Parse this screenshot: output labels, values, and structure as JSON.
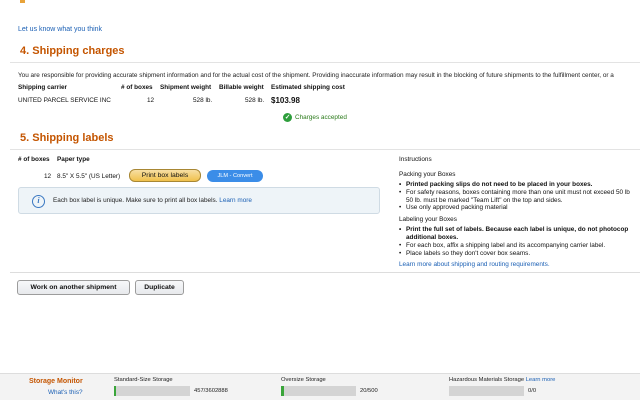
{
  "feedback_link": "Let us know what you think",
  "charges": {
    "title": "4. Shipping charges",
    "responsibility": "You are responsible for providing accurate shipment information and for the actual cost of the shipment. Providing inaccurate information may result in the blocking of future shipments to the fulfillment center, or a",
    "headers": {
      "carrier": "Shipping carrier",
      "boxes": "# of boxes",
      "weight": "Shipment weight",
      "billable": "Billable weight",
      "cost": "Estimated shipping cost"
    },
    "row": {
      "carrier": "UNITED PARCEL SERVICE INC",
      "boxes": "12",
      "weight": "528 lb.",
      "billable": "528 lb.",
      "cost": "$103.98"
    },
    "status": "Charges accepted"
  },
  "labels": {
    "title": "5. Shipping labels",
    "headers": {
      "boxes": "# of boxes",
      "paper": "Paper type"
    },
    "row": {
      "boxes": "12",
      "paper": "8.5\" X 5.5\" (US Letter)"
    },
    "print_button": "Print box labels",
    "jlm_button": "JLM - Convert",
    "info_text": "Each box label is unique. Make sure to print all box labels.",
    "info_link": "Learn more"
  },
  "instructions": {
    "heading": "Instructions",
    "packing_heading": "Packing your Boxes",
    "packing": [
      {
        "text": "Printed packing slips do not need to be placed in your boxes.",
        "bold": true
      },
      {
        "text": "For safety reasons, boxes containing more than one unit must not exceed 50 lb",
        "bold": false
      },
      {
        "text": "50 lb. must be marked \"Team Lift\" on the top and sides.",
        "bold": false,
        "cont": true
      },
      {
        "text": "Use only approved packing material",
        "bold": false
      }
    ],
    "labeling_heading": "Labeling your Boxes",
    "labeling": [
      {
        "text": "Print the full set of labels. Because each label is unique, do not photocop",
        "bold": true
      },
      {
        "text": "additional boxes.",
        "bold": true,
        "cont": true
      },
      {
        "text": "For each box, affix a shipping label and its accompanying carrier label.",
        "bold": false
      },
      {
        "text": "Place labels so they don't cover box seams.",
        "bold": false
      }
    ],
    "learn_more": "Learn more about shipping and routing requirements."
  },
  "actions": {
    "work_on_another": "Work on another shipment",
    "duplicate": "Duplicate"
  },
  "storage_monitor": {
    "title": "Storage Monitor",
    "whats_this": "What's this?",
    "standard": {
      "label": "Standard-Size Storage",
      "count": "457/3602888",
      "fraction": 0.0001
    },
    "oversize": {
      "label": "Oversize Storage",
      "count": "20/500",
      "fraction": 0.04
    },
    "hazmat": {
      "label": "Hazardous Materials Storage",
      "link": "Learn more",
      "count": "0/0",
      "fraction": 0
    }
  },
  "colors": {
    "section_title": "#c45500",
    "link": "#1a5fb4",
    "accepted": "#2e9e3c",
    "print_button": "#f0c14b",
    "jlm_button": "#3b8de8"
  }
}
